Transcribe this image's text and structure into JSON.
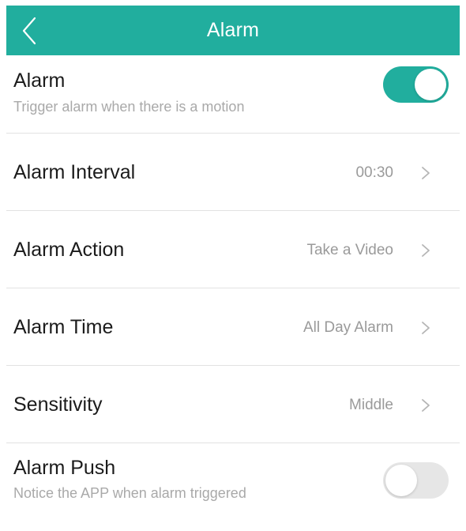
{
  "header": {
    "title": "Alarm",
    "back_icon": "chevron-left-icon"
  },
  "colors": {
    "accent": "#21ae9e",
    "toggle_off": "#e6e6e6"
  },
  "alarm": {
    "label": "Alarm",
    "subtitle": "Trigger alarm when there is a motion",
    "enabled": true
  },
  "alarm_interval": {
    "label": "Alarm Interval",
    "value": "00:30"
  },
  "alarm_action": {
    "label": "Alarm Action",
    "value": "Take a Video"
  },
  "alarm_time": {
    "label": "Alarm Time",
    "value": "All Day Alarm"
  },
  "sensitivity": {
    "label": "Sensitivity",
    "value": "Middle"
  },
  "alarm_push": {
    "label": "Alarm Push",
    "subtitle": "Notice the APP when alarm triggered",
    "enabled": false
  }
}
